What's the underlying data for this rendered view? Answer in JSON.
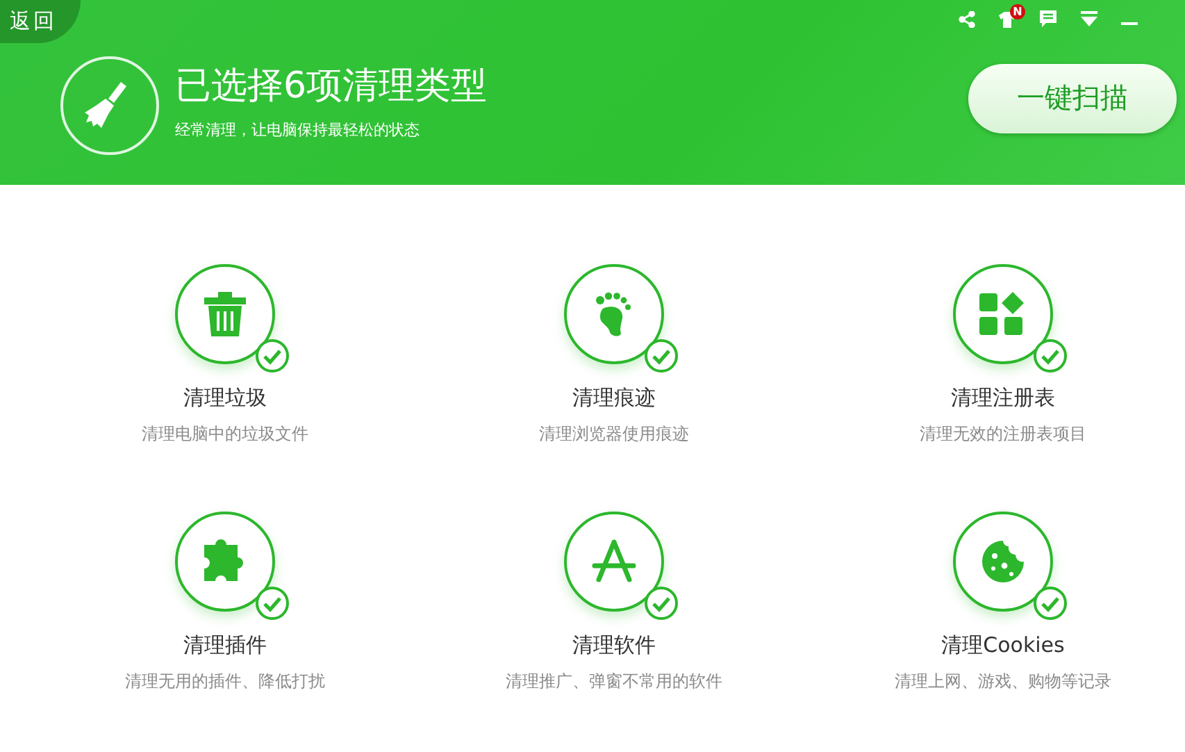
{
  "header": {
    "back": "返回",
    "notification_badge": "N",
    "title": "已选择6项清理类型",
    "subtitle": "经常清理，让电脑保持最轻松的状态",
    "scan_button": "一键扫描"
  },
  "items": [
    {
      "title": "清理垃圾",
      "description": "清理电脑中的垃圾文件",
      "checked": true
    },
    {
      "title": "清理痕迹",
      "description": "清理浏览器使用痕迹",
      "checked": true
    },
    {
      "title": "清理注册表",
      "description": "清理无效的注册表项目",
      "checked": true
    },
    {
      "title": "清理插件",
      "description": "清理无用的插件、降低打扰",
      "checked": true
    },
    {
      "title": "清理软件",
      "description": "清理推广、弹窗不常用的软件",
      "checked": true
    },
    {
      "title": "清理Cookies",
      "description": "清理上网、游戏、购物等记录",
      "checked": true
    }
  ]
}
